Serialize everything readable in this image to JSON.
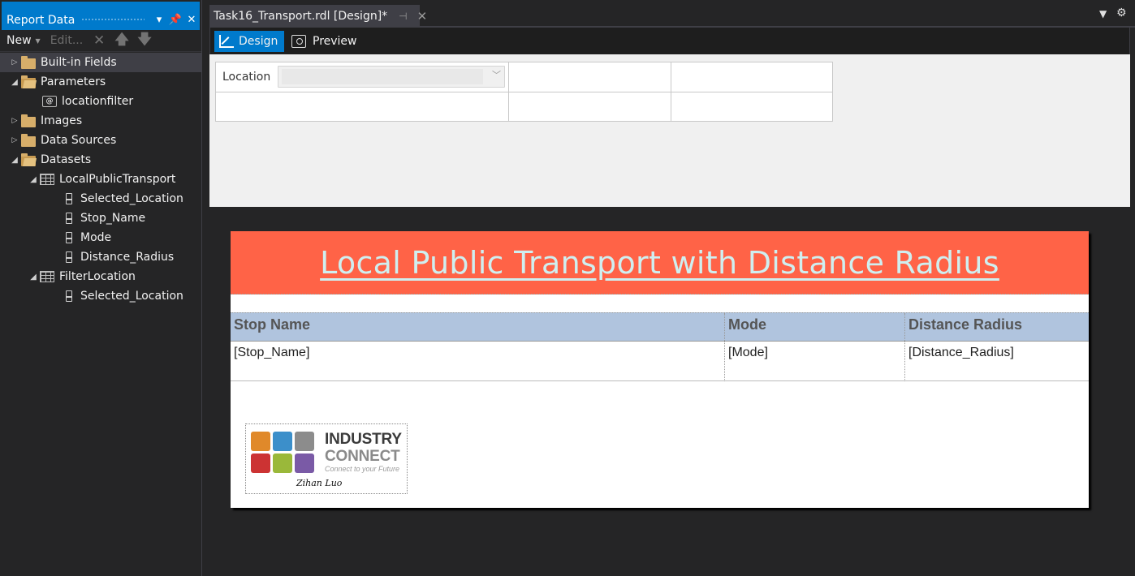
{
  "report_data_panel": {
    "title": "Report Data",
    "toolbar": {
      "new_label": "New",
      "edit_label": "Edit..."
    },
    "tree": {
      "built_in_fields": "Built-in Fields",
      "parameters": "Parameters",
      "locationfilter": "locationfilter",
      "images": "Images",
      "data_sources": "Data Sources",
      "datasets": "Datasets",
      "local_public_transport": "LocalPublicTransport",
      "lpt_fields": [
        "Selected_Location",
        "Stop_Name",
        "Mode",
        "Distance_Radius"
      ],
      "filter_location": "FilterLocation",
      "fl_fields": [
        "Selected_Location"
      ]
    }
  },
  "document_tab": {
    "title": "Task16_Transport.rdl [Design]*"
  },
  "view_tabs": {
    "design": "Design",
    "preview": "Preview"
  },
  "parameter_area": {
    "location_label": "Location",
    "location_value": ""
  },
  "report": {
    "title": "Local Public Transport with Distance Radius",
    "table": {
      "headers": [
        "Stop Name",
        "Mode",
        "Distance Radius"
      ],
      "row": [
        "[Stop_Name]",
        "[Mode]",
        "[Distance_Radius]"
      ]
    },
    "logo": {
      "line1": "INDUSTRY",
      "line2": "CONNECT",
      "tagline": "Connect to your Future",
      "signature": "Zihan Luo"
    }
  },
  "colors": {
    "accent": "#007acc",
    "title_band": "#ff6347",
    "title_text": "#cfeff0",
    "header_row": "#b0c4de"
  },
  "icons": {
    "close": "close-icon",
    "pin": "pin-icon",
    "delete": "delete-icon",
    "move_up": "arrow-up-icon",
    "move_down": "arrow-down-icon",
    "folder": "folder-icon",
    "field": "field-icon",
    "table": "dataset-icon",
    "parameter": "parameter-icon"
  }
}
